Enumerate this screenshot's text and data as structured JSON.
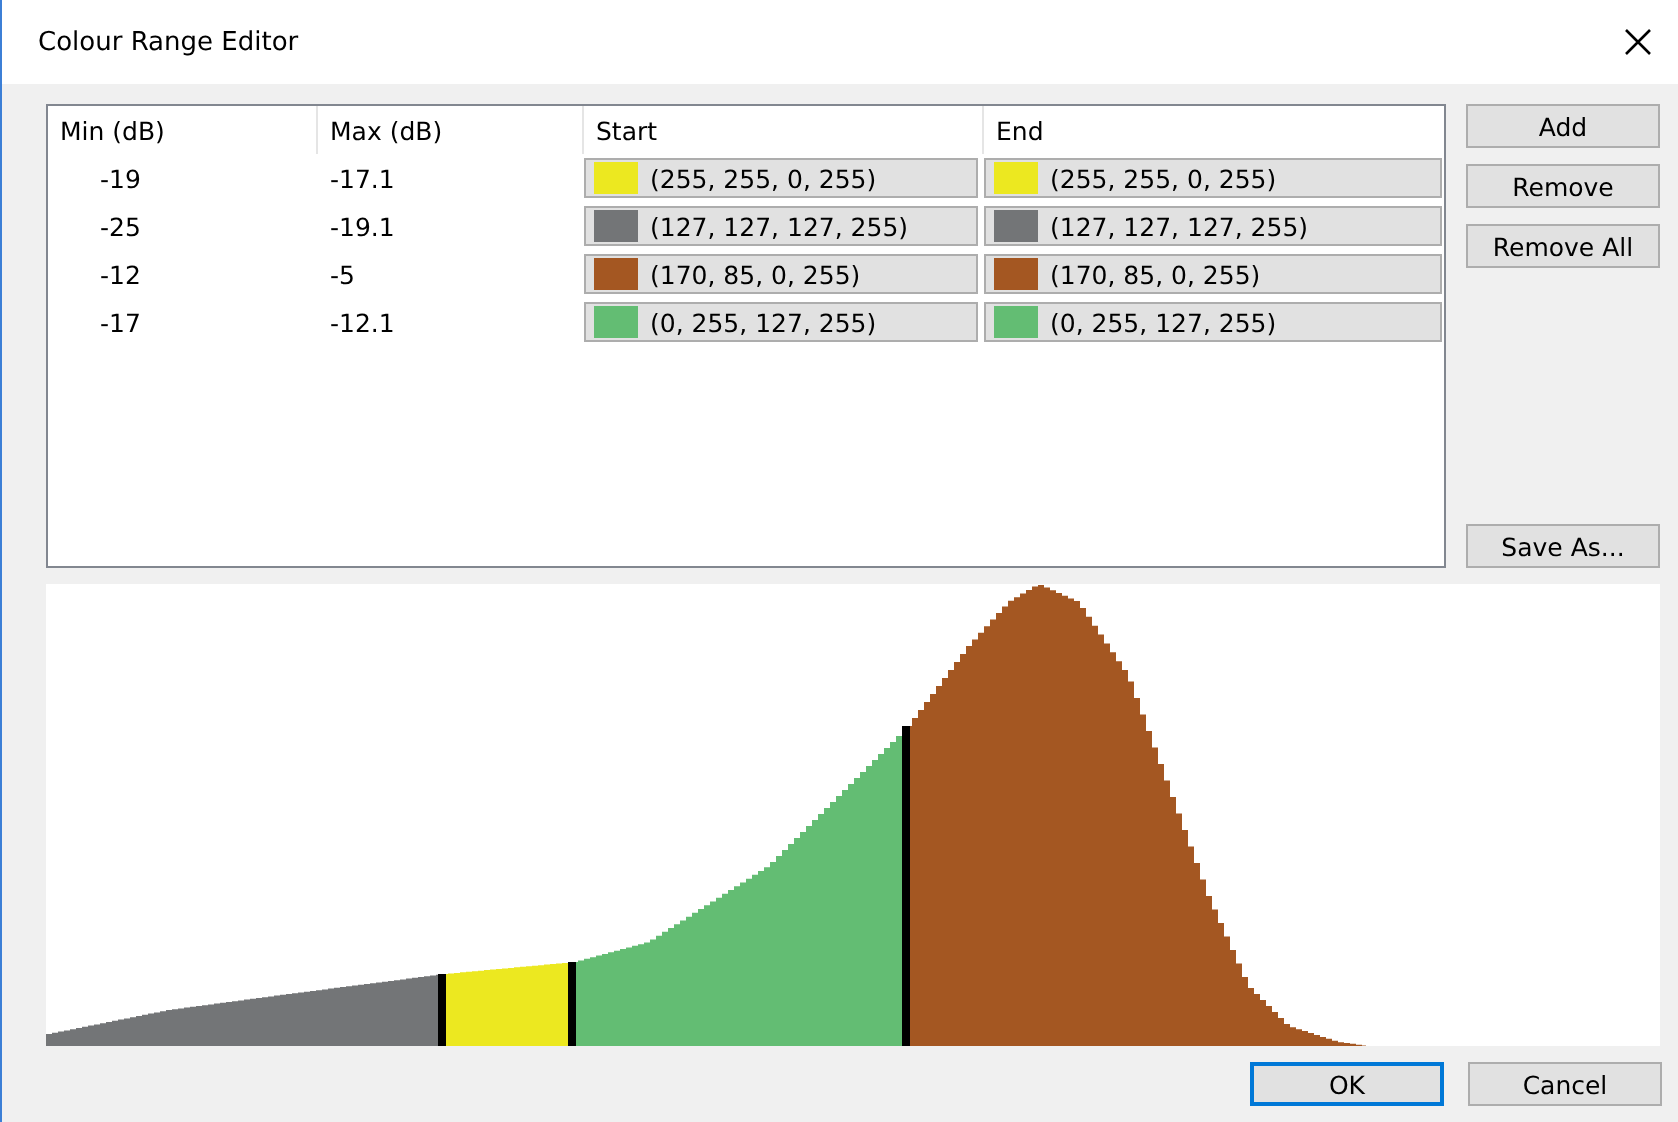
{
  "window": {
    "title": "Colour Range Editor"
  },
  "table": {
    "columns": [
      "Min (dB)",
      "Max (dB)",
      "Start",
      "End"
    ],
    "rows": [
      {
        "min": "-19",
        "max": "-17.1",
        "start": {
          "color": "#ece820",
          "text": "(255, 255, 0, 255)"
        },
        "end": {
          "color": "#ece820",
          "text": "(255, 255, 0, 255)"
        }
      },
      {
        "min": "-25",
        "max": "-19.1",
        "start": {
          "color": "#737577",
          "text": "(127, 127, 127, 255)"
        },
        "end": {
          "color": "#737577",
          "text": "(127, 127, 127, 255)"
        }
      },
      {
        "min": "-12",
        "max": "-5",
        "start": {
          "color": "#a45722",
          "text": "(170, 85, 0, 255)"
        },
        "end": {
          "color": "#a45722",
          "text": "(170, 85, 0, 255)"
        }
      },
      {
        "min": "-17",
        "max": "-12.1",
        "start": {
          "color": "#63bd73",
          "text": "(0, 255, 127, 255)"
        },
        "end": {
          "color": "#63bd73",
          "text": "(0, 255, 127, 255)"
        }
      }
    ]
  },
  "side_buttons": [
    "Add",
    "Remove",
    "Remove All"
  ],
  "save_button": "Save As...",
  "footer_buttons": [
    {
      "label": "OK",
      "selected": true
    },
    {
      "label": "Cancel",
      "selected": false
    }
  ]
}
